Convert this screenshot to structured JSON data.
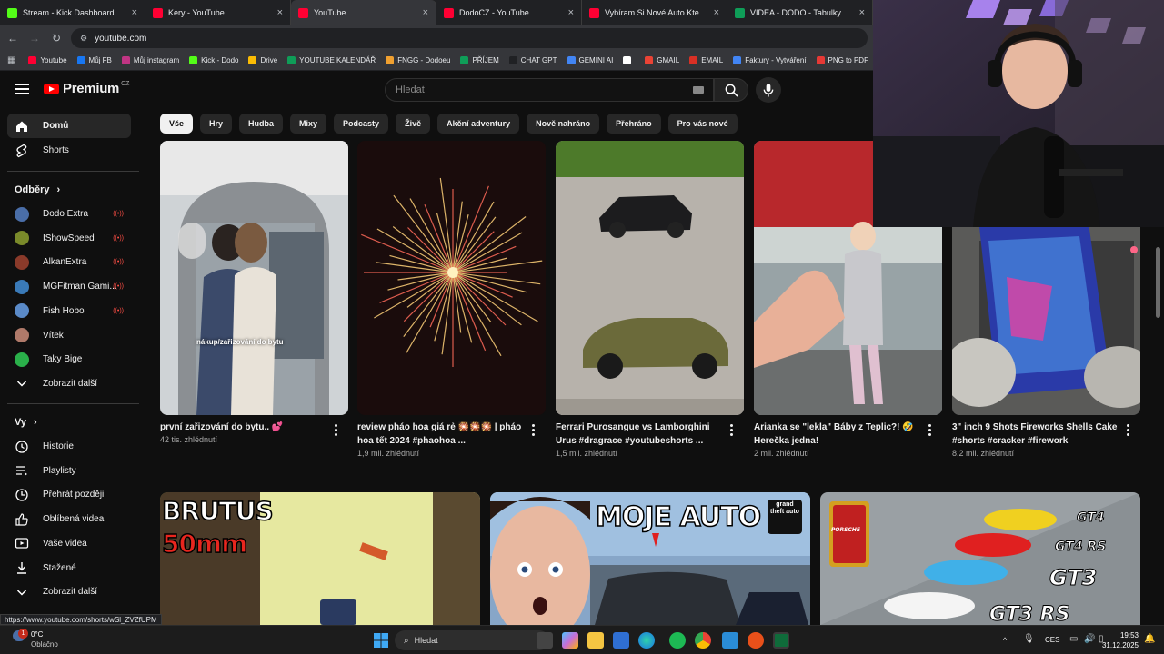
{
  "browser": {
    "tabs": [
      {
        "title": "Stream - Kick Dashboard",
        "color": "#53fc18",
        "active": false
      },
      {
        "title": "Kery - YouTube",
        "color": "#ff0033",
        "active": false
      },
      {
        "title": "YouTube",
        "color": "#ff0033",
        "active": true
      },
      {
        "title": "DodoCZ - YouTube",
        "color": "#ff0033",
        "active": false
      },
      {
        "title": "Vybíram Si Nové Auto Které Si",
        "color": "#ff0033",
        "active": false
      },
      {
        "title": "VIDEA - DODO - Tabulky Goog",
        "color": "#0f9d58",
        "active": false
      }
    ],
    "url": "youtube.com",
    "bookmarks": [
      {
        "label": "Youtube",
        "color": "#ff0033"
      },
      {
        "label": "Můj FB",
        "color": "#1877f2"
      },
      {
        "label": "Můj instagram",
        "color": "#c13584"
      },
      {
        "label": "Kick - Dodo",
        "color": "#53fc18"
      },
      {
        "label": "Drive",
        "color": "#fbbc04"
      },
      {
        "label": "YOUTUBE KALENDÁŘ",
        "color": "#0f9d58"
      },
      {
        "label": "FNGG - Dodoeu",
        "color": "#f0a030"
      },
      {
        "label": "PŘÍJEM",
        "color": "#0f9d58"
      },
      {
        "label": "CHAT GPT",
        "color": "#202124"
      },
      {
        "label": "GEMINI AI",
        "color": "#4285f4"
      },
      {
        "label": "",
        "color": "#ffffff"
      },
      {
        "label": "GMAIL",
        "color": "#ea4335"
      },
      {
        "label": "EMAIL",
        "color": "#d93025"
      },
      {
        "label": "Faktury - Vytváření",
        "color": "#4285f4"
      },
      {
        "label": "PNG to PDF",
        "color": "#e53935"
      }
    ]
  },
  "youtube": {
    "logo_text": "Premium",
    "logo_sup": "CZ",
    "search_placeholder": "Hledat",
    "sidebar": {
      "main": [
        {
          "label": "Domů",
          "icon": "home-icon",
          "active": true
        },
        {
          "label": "Shorts",
          "icon": "shorts-icon",
          "active": false
        }
      ],
      "subs_header": "Odběry",
      "subs": [
        {
          "label": "Dodo Extra",
          "color": "#4a6ea8",
          "live": true
        },
        {
          "label": "IShowSpeed",
          "color": "#7a8a2a",
          "live": true
        },
        {
          "label": "AlkanExtra",
          "color": "#8a3a2a",
          "live": true
        },
        {
          "label": "MGFitman Gami...",
          "color": "#3a7ab8",
          "live": true
        },
        {
          "label": "Fish Hobo",
          "color": "#5a8ac8",
          "live": true
        },
        {
          "label": "Vítek",
          "color": "#b07a6a",
          "live": false
        },
        {
          "label": "Taky Bige",
          "color": "#2ab04a",
          "live": false
        },
        {
          "label": "Zobrazit další",
          "color": "",
          "live": false
        }
      ],
      "you_header": "Vy",
      "you": [
        {
          "label": "Historie",
          "icon": "history-icon"
        },
        {
          "label": "Playlisty",
          "icon": "playlist-icon"
        },
        {
          "label": "Přehrát později",
          "icon": "watch-later-icon"
        },
        {
          "label": "Oblíbená videa",
          "icon": "like-icon"
        },
        {
          "label": "Vaše videa",
          "icon": "your-videos-icon"
        },
        {
          "label": "Stažené",
          "icon": "download-icon"
        },
        {
          "label": "Zobrazit další",
          "icon": "chevron-down-icon"
        }
      ]
    },
    "chips": [
      "Vše",
      "Hry",
      "Hudba",
      "Mixy",
      "Podcasty",
      "Živě",
      "Akční adventury",
      "Nově nahráno",
      "Přehráno",
      "Pro vás nové"
    ],
    "shorts": [
      {
        "title": "první zařizování do bytu.. 💕",
        "views": "42 tis. zhlédnutí",
        "overlay": "nákup/zařizování do bytu"
      },
      {
        "title": "review pháo hoa giá rẻ 🎇🎇🎇 | pháo hoa tết 2024 #phaohoa ...",
        "views": "1,9 mil. zhlédnutí",
        "overlay": ""
      },
      {
        "title": "Ferrari Purosangue vs Lamborghini Urus #dragrace #youtubeshorts ...",
        "views": "1,5 mil. zhlédnutí",
        "overlay": ""
      },
      {
        "title": "Arianka se \"lekla\" Báby z Teplic?! 🤣 Herečka jedna!",
        "views": "2 mil. zhlédnutí",
        "overlay": ""
      },
      {
        "title": "3\" inch 9 Shots Fireworks Shells Cake #shorts #cracker #firework",
        "views": "8,2 mil. zhlédnutí",
        "overlay": ""
      }
    ],
    "videos": [
      {
        "thumb_text_1": "BRUTUS",
        "thumb_text_2": "50mm"
      },
      {
        "thumb_text_1": "MOJE AUTO",
        "thumb_text_2": "grand theft auto"
      },
      {
        "thumb_text_1": "GT4",
        "thumb_text_2": "GT4 RS",
        "thumb_text_3": "GT3",
        "thumb_text_4": "GT3 RS",
        "thumb_text_5": "PORSCHE"
      }
    ]
  },
  "status_url": "https://www.youtube.com/shorts/wSl_ZVZfUPM",
  "taskbar": {
    "weather_temp": "0°C",
    "weather_desc": "Oblačno",
    "notif_count": "1",
    "search_placeholder": "Hledat",
    "lang": "CES",
    "time": "19:53",
    "date": "31.12.2025"
  }
}
